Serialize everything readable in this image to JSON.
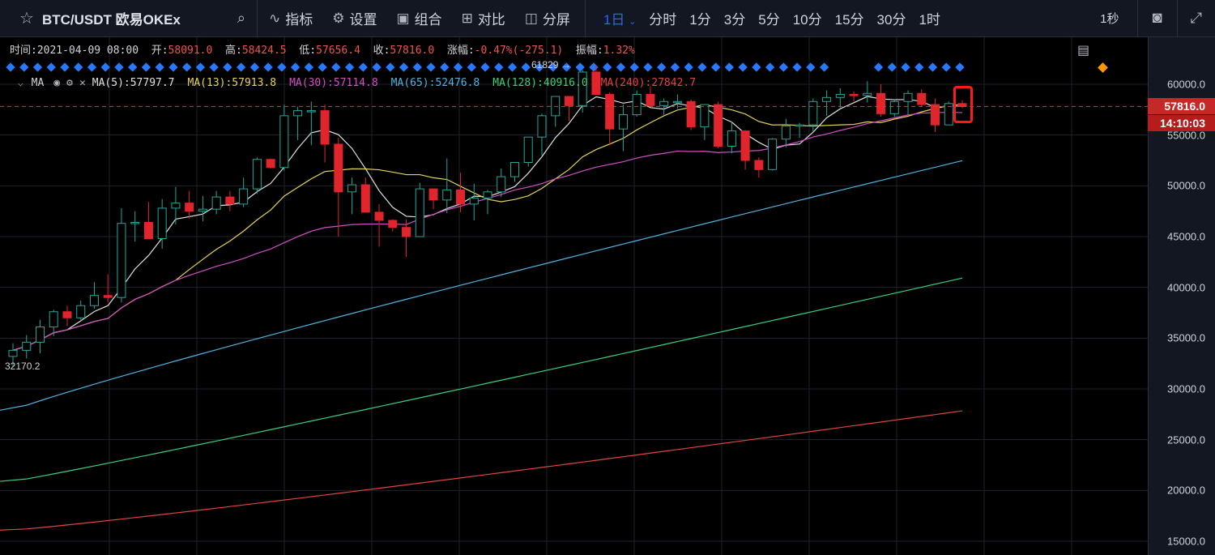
{
  "toolbar": {
    "symbol": "BTC/USDT 欧易OKEx",
    "tools": [
      {
        "label": "指标",
        "icon": "indicator-icon"
      },
      {
        "label": "设置",
        "icon": "gear-icon"
      },
      {
        "label": "组合",
        "icon": "layout-icon"
      },
      {
        "label": "对比",
        "icon": "compare-icon"
      },
      {
        "label": "分屏",
        "icon": "split-screen-icon"
      }
    ],
    "active_interval": "1日",
    "intervals": [
      "分时",
      "1分",
      "3分",
      "5分",
      "10分",
      "15分",
      "30分",
      "1时"
    ],
    "seconds_label": "1秒"
  },
  "ohlc": {
    "time_label": "时间:",
    "time": "2021-04-09 08:00",
    "open_label": "开:",
    "open": "58091.0",
    "high_label": "高:",
    "high": "58424.5",
    "low_label": "低:",
    "low": "57656.4",
    "close_label": "收:",
    "close": "57816.0",
    "change_label": "涨幅:",
    "change": "-0.47%(-275.1)",
    "amplitude_label": "振幅:",
    "amplitude": "1.32%"
  },
  "ma_legend": {
    "title": "MA",
    "items": [
      {
        "label": "MA(5):57797.7",
        "color": "#e0e0e0"
      },
      {
        "label": "MA(13):57913.8",
        "color": "#e6d35a"
      },
      {
        "label": "MA(30):57114.8",
        "color": "#d24fc4"
      },
      {
        "label": "MA(65):52476.8",
        "color": "#4fb3e0"
      },
      {
        "label": "MA(128):40916.0",
        "color": "#3ccf7a"
      },
      {
        "label": "MA(240):27842.7",
        "color": "#e0443e"
      }
    ]
  },
  "markers": {
    "high": "61829 →",
    "low": "32170.2"
  },
  "price_tag": "57816.0",
  "time_tag": "14:10:03",
  "colors": {
    "up": "#26a69a",
    "down": "#e0262c",
    "marker": "#2979ff",
    "current_line": "#e53935"
  },
  "chart_data": {
    "type": "candlestick",
    "symbol": "BTC/USDT",
    "interval": "1日",
    "ylim": [
      14000,
      62500
    ],
    "yticks": [
      15000,
      20000,
      25000,
      30000,
      35000,
      40000,
      45000,
      50000,
      55000,
      60000
    ],
    "ytick_labels": [
      "15000.0",
      "20000.0",
      "25000.0",
      "30000.0",
      "35000.0",
      "40000.0",
      "45000.0",
      "50000.0",
      "55000.0",
      "60000.0"
    ],
    "current_price": 57816.0,
    "candles": [
      [
        33200,
        34500,
        32170,
        33800
      ],
      [
        33800,
        35300,
        33000,
        34600
      ],
      [
        34600,
        36800,
        33500,
        36100
      ],
      [
        36100,
        37800,
        35200,
        37600
      ],
      [
        37600,
        38200,
        36200,
        37000
      ],
      [
        37000,
        38700,
        36800,
        38200
      ],
      [
        38200,
        40500,
        37900,
        39200
      ],
      [
        39200,
        41300,
        38500,
        39000
      ],
      [
        39000,
        47800,
        38500,
        46300
      ],
      [
        46300,
        47500,
        44500,
        46400
      ],
      [
        46400,
        48400,
        44800,
        44800
      ],
      [
        44800,
        48700,
        43800,
        47800
      ],
      [
        47800,
        49900,
        46200,
        48300
      ],
      [
        48300,
        49500,
        46800,
        47500
      ],
      [
        47500,
        49000,
        46500,
        47700
      ],
      [
        47700,
        49500,
        47200,
        48900
      ],
      [
        48900,
        49500,
        47500,
        48200
      ],
      [
        48200,
        50800,
        47900,
        49700
      ],
      [
        49700,
        52800,
        49200,
        52600
      ],
      [
        52600,
        52700,
        51700,
        51800
      ],
      [
        51800,
        58000,
        51500,
        56900
      ],
      [
        56900,
        57800,
        54500,
        57400
      ],
      [
        57400,
        58300,
        54000,
        57400
      ],
      [
        57400,
        58000,
        52300,
        54100
      ],
      [
        54100,
        54700,
        45000,
        49400
      ],
      [
        49400,
        50800,
        47200,
        50100
      ],
      [
        50100,
        50800,
        47400,
        47400
      ],
      [
        47400,
        48200,
        44000,
        46600
      ],
      [
        46600,
        46700,
        45500,
        45900
      ],
      [
        45900,
        46700,
        43000,
        45000
      ],
      [
        45000,
        50300,
        45000,
        49700
      ],
      [
        49700,
        49700,
        47700,
        48600
      ],
      [
        48600,
        52700,
        47300,
        49600
      ],
      [
        49600,
        51300,
        47400,
        48200
      ],
      [
        48200,
        50200,
        46600,
        48800
      ],
      [
        48800,
        49600,
        47200,
        49400
      ],
      [
        49400,
        51700,
        48900,
        50900
      ],
      [
        50900,
        52300,
        50400,
        52300
      ],
      [
        52300,
        54800,
        51900,
        54800
      ],
      [
        54800,
        57100,
        53000,
        56900
      ],
      [
        56900,
        58800,
        55800,
        58800
      ],
      [
        58800,
        58800,
        56400,
        57900
      ],
      [
        57900,
        61400,
        57200,
        61200
      ],
      [
        61200,
        61829,
        59000,
        59000
      ],
      [
        59000,
        59200,
        54000,
        55600
      ],
      [
        55600,
        58000,
        53400,
        57000
      ],
      [
        57000,
        59400,
        56800,
        59000
      ],
      [
        59000,
        59800,
        57800,
        57900
      ],
      [
        57900,
        58600,
        57000,
        58300
      ],
      [
        58300,
        59000,
        57600,
        58300
      ],
      [
        58300,
        58500,
        55500,
        55800
      ],
      [
        55800,
        58000,
        54500,
        58000
      ],
      [
        58000,
        58300,
        53700,
        53900
      ],
      [
        53900,
        56300,
        53200,
        55400
      ],
      [
        55400,
        55500,
        51600,
        52500
      ],
      [
        52500,
        52800,
        50800,
        51600
      ],
      [
        51600,
        54700,
        51500,
        54600
      ],
      [
        54600,
        56600,
        53800,
        55900
      ],
      [
        55900,
        56200,
        54700,
        56000
      ],
      [
        56000,
        58600,
        55300,
        58300
      ],
      [
        58300,
        59400,
        56900,
        58700
      ],
      [
        58700,
        59600,
        57700,
        59000
      ],
      [
        59000,
        59300,
        58300,
        58900
      ],
      [
        58900,
        60300,
        58200,
        59100
      ],
      [
        59100,
        60000,
        56800,
        57100
      ],
      [
        57100,
        58500,
        56800,
        58300
      ],
      [
        58300,
        59400,
        57000,
        59100
      ],
      [
        59100,
        59500,
        57800,
        58000
      ],
      [
        58000,
        58600,
        55300,
        56000
      ],
      [
        56000,
        58300,
        56000,
        58100
      ],
      [
        58100,
        58424.5,
        57656.4,
        57816
      ]
    ]
  }
}
